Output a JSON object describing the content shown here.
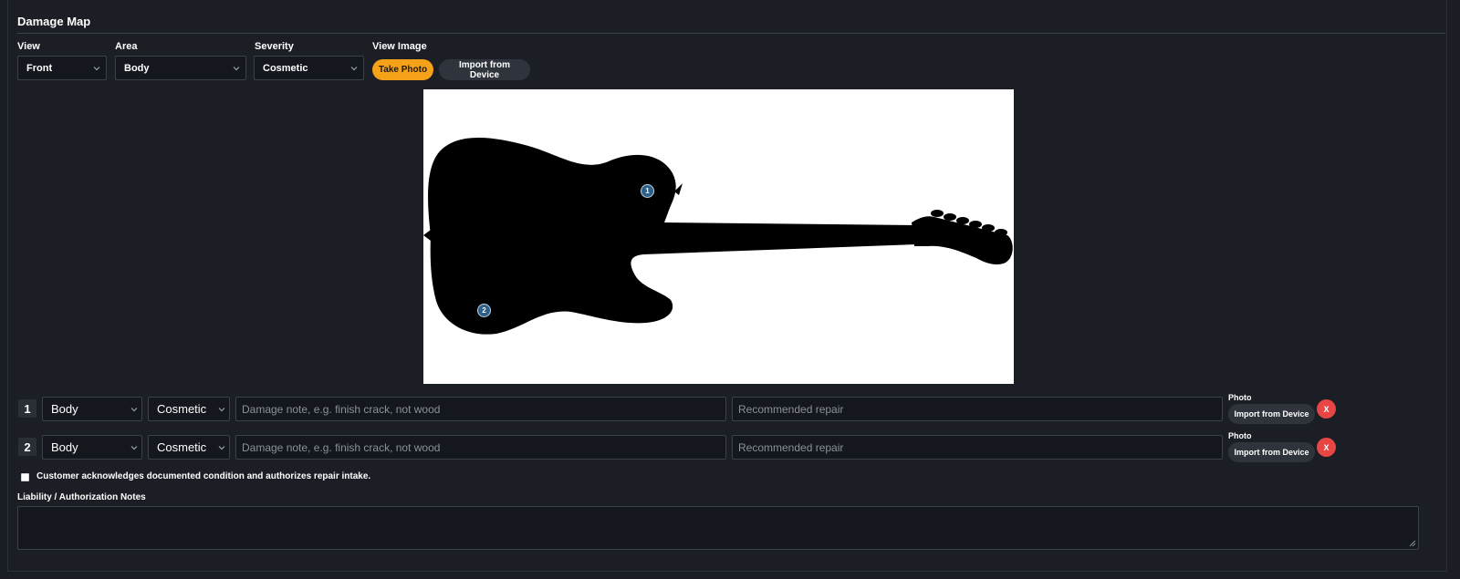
{
  "section": {
    "title": "Damage Map"
  },
  "controls": {
    "view": {
      "label": "View",
      "value": "Front"
    },
    "area": {
      "label": "Area",
      "value": "Body"
    },
    "severity": {
      "label": "Severity",
      "value": "Cosmetic"
    },
    "view_image": {
      "label": "View Image",
      "take_photo": "Take Photo",
      "import": "Import from Device"
    }
  },
  "markers": [
    {
      "number": "1"
    },
    {
      "number": "2"
    }
  ],
  "rows": [
    {
      "number": "1",
      "area": "Body",
      "severity": "Cosmetic",
      "note": "",
      "note_placeholder": "Damage note, e.g. finish crack, not wood",
      "repair": "",
      "repair_placeholder": "Recommended repair",
      "photo_label": "Photo",
      "import": "Import from Device",
      "delete": "X"
    },
    {
      "number": "2",
      "area": "Body",
      "severity": "Cosmetic",
      "note": "",
      "note_placeholder": "Damage note, e.g. finish crack, not wood",
      "repair": "",
      "repair_placeholder": "Recommended repair",
      "photo_label": "Photo",
      "import": "Import from Device",
      "delete": "X"
    }
  ],
  "acknowledge": {
    "checked": false,
    "label": "Customer acknowledges documented condition and authorizes repair intake."
  },
  "liability": {
    "label": "Liability / Authorization Notes",
    "value": ""
  },
  "colors": {
    "accent": "#f5a218",
    "danger": "#e84545",
    "marker": "#2e5f87",
    "background": "#1b1e25"
  }
}
